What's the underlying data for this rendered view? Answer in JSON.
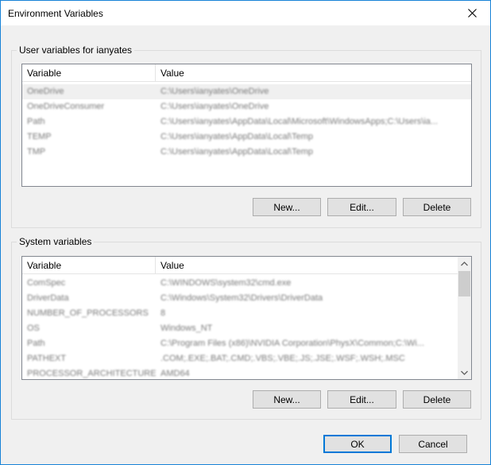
{
  "window": {
    "title": "Environment Variables"
  },
  "user_vars": {
    "label": "User variables for ianyates",
    "columns": [
      "Variable",
      "Value"
    ],
    "rows": [
      {
        "variable": "OneDrive",
        "value": "C:\\Users\\ianyates\\OneDrive"
      },
      {
        "variable": "OneDriveConsumer",
        "value": "C:\\Users\\ianyates\\OneDrive"
      },
      {
        "variable": "Path",
        "value": "C:\\Users\\ianyates\\AppData\\Local\\Microsoft\\WindowsApps;C:\\Users\\ia..."
      },
      {
        "variable": "TEMP",
        "value": "C:\\Users\\ianyates\\AppData\\Local\\Temp"
      },
      {
        "variable": "TMP",
        "value": "C:\\Users\\ianyates\\AppData\\Local\\Temp"
      }
    ],
    "buttons": {
      "new": "New...",
      "edit": "Edit...",
      "delete": "Delete"
    }
  },
  "system_vars": {
    "label": "System variables",
    "columns": [
      "Variable",
      "Value"
    ],
    "rows": [
      {
        "variable": "ComSpec",
        "value": "C:\\WINDOWS\\system32\\cmd.exe"
      },
      {
        "variable": "DriverData",
        "value": "C:\\Windows\\System32\\Drivers\\DriverData"
      },
      {
        "variable": "NUMBER_OF_PROCESSORS",
        "value": "8"
      },
      {
        "variable": "OS",
        "value": "Windows_NT"
      },
      {
        "variable": "Path",
        "value": "C:\\Program Files (x86)\\NVIDIA Corporation\\PhysX\\Common;C:\\Wi..."
      },
      {
        "variable": "PATHEXT",
        "value": ".COM;.EXE;.BAT;.CMD;.VBS;.VBE;.JS;.JSE;.WSF;.WSH;.MSC"
      },
      {
        "variable": "PROCESSOR_ARCHITECTURE",
        "value": "AMD64"
      }
    ],
    "buttons": {
      "new": "New...",
      "edit": "Edit...",
      "delete": "Delete"
    }
  },
  "footer": {
    "ok": "OK",
    "cancel": "Cancel"
  }
}
